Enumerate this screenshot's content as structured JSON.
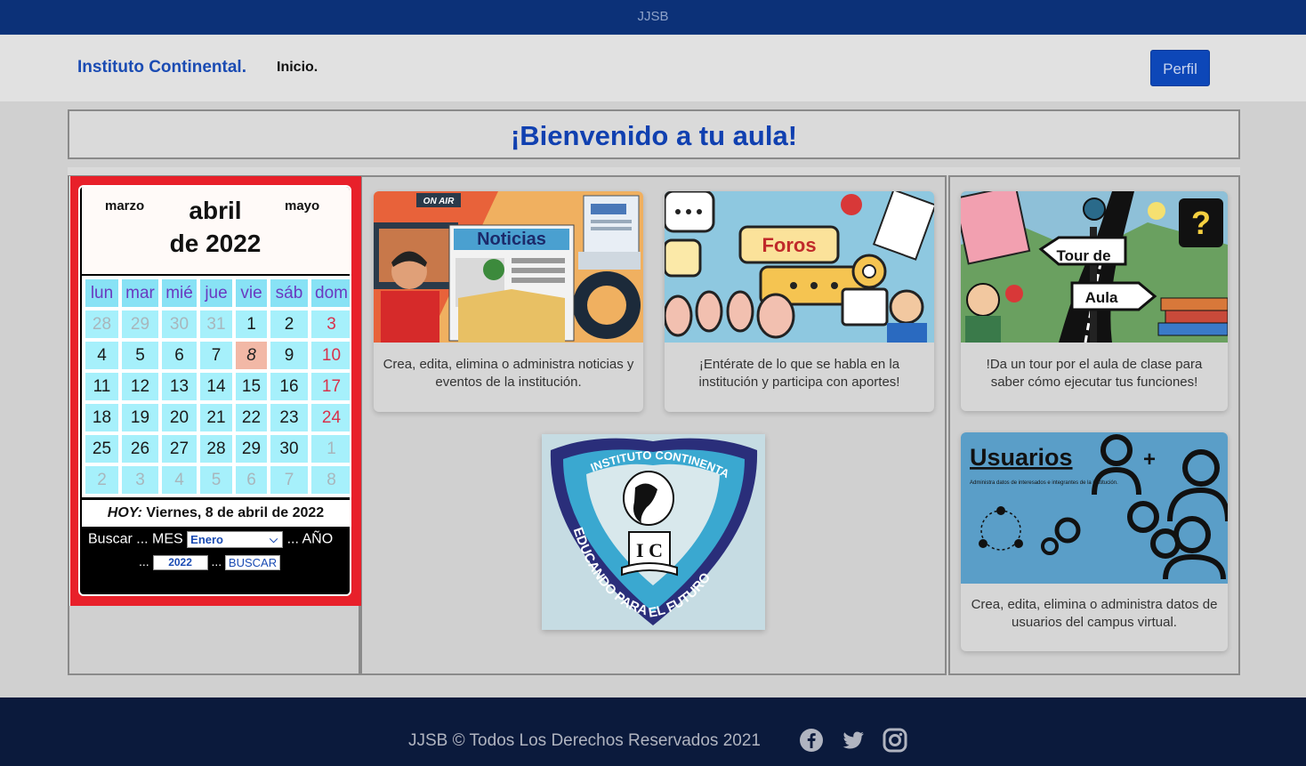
{
  "topbar": {
    "title": "JJSB"
  },
  "nav": {
    "brand": "Instituto Continental.",
    "inicio": "Inicio.",
    "perfil": "Perfil"
  },
  "welcome": {
    "title": "¡Bienvenido a tu aula!"
  },
  "calendar": {
    "prev_month": "marzo",
    "next_month": "mayo",
    "month": "abril",
    "year_line": "de 2022",
    "weekdays": [
      "lun",
      "mar",
      "mié",
      "jue",
      "vie",
      "sáb",
      "dom"
    ],
    "weeks": [
      [
        "28",
        "29",
        "30",
        "31",
        "1",
        "2",
        "3"
      ],
      [
        "4",
        "5",
        "6",
        "7",
        "8",
        "9",
        "10"
      ],
      [
        "11",
        "12",
        "13",
        "14",
        "15",
        "16",
        "17"
      ],
      [
        "18",
        "19",
        "20",
        "21",
        "22",
        "23",
        "24"
      ],
      [
        "25",
        "26",
        "27",
        "28",
        "29",
        "30",
        "1"
      ],
      [
        "2",
        "3",
        "4",
        "5",
        "6",
        "7",
        "8"
      ]
    ],
    "today_day": "8",
    "today_label": "HOY:",
    "today_text": "Viernes, 8 de abril de 2022",
    "search": {
      "buscar": "Buscar ...",
      "mes": "MES",
      "mes_value": "Enero",
      "anio": "... AÑO",
      "dots_a": "...",
      "anio_value": "2022",
      "dots_b": "...",
      "buscar_button": "BUSCAR"
    }
  },
  "cards": {
    "noticias": {
      "image_title": "Noticias",
      "on_air": "ON AIR",
      "text": "Crea, edita, elimina o administra noticias y eventos de la institución."
    },
    "foros": {
      "image_title": "Foros",
      "text": "¡Entérate de lo que se habla en la institución y participa con aportes!"
    },
    "tour": {
      "image_title_1": "Tour de",
      "image_title_2": "Aula",
      "text": "!Da un tour por el aula de clase para saber cómo ejecutar tus funciones!"
    },
    "usuarios": {
      "image_title": "Usuarios",
      "image_sub": "Administra datos de interesados e integrantes de la institución.",
      "text": "Crea, edita, elimina o administra datos de usuarios del campus virtual."
    }
  },
  "logo": {
    "arc_top": "INSTITUTO CONTINENTAL",
    "arc_bottom": "EDUCANDO PARA EL FUTURO",
    "monogram": "I C"
  },
  "footer": {
    "text": "JJSB © Todos Los Derechos Reservados 2021",
    "icons": [
      "facebook-icon",
      "twitter-icon",
      "instagram-icon"
    ]
  },
  "colors": {
    "topbar": "#0c3178",
    "brand": "#1a4bb3",
    "calendar_border": "#e8202a",
    "footer": "#0b1a3c"
  }
}
